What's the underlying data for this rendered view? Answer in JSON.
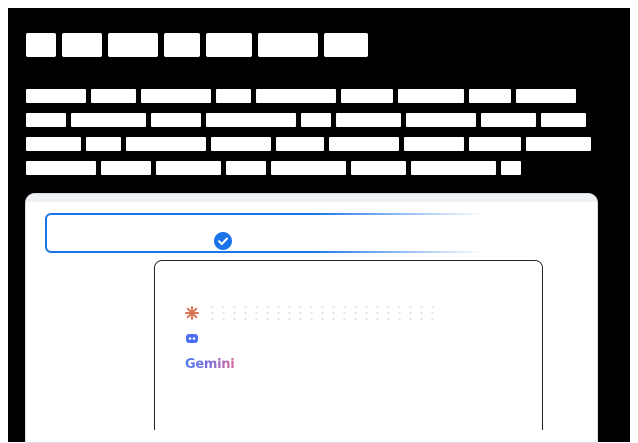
{
  "colors": {
    "accent": "#1a73e8",
    "panel_border": "#20232a",
    "claude_orange": "#d97757",
    "copilot_blue": "#4a6cf7"
  },
  "heading": {
    "redacted": true
  },
  "paragraph": {
    "redacted": true,
    "lines": 4
  },
  "model_picker": {
    "selected_check_icon": "check-circle-icon",
    "options": [
      {
        "icon": "claude-logo-icon"
      },
      {
        "icon": "copilot-logo-icon"
      },
      {
        "icon": "gemini-logo-icon",
        "logo_text": "Gemini"
      }
    ]
  }
}
